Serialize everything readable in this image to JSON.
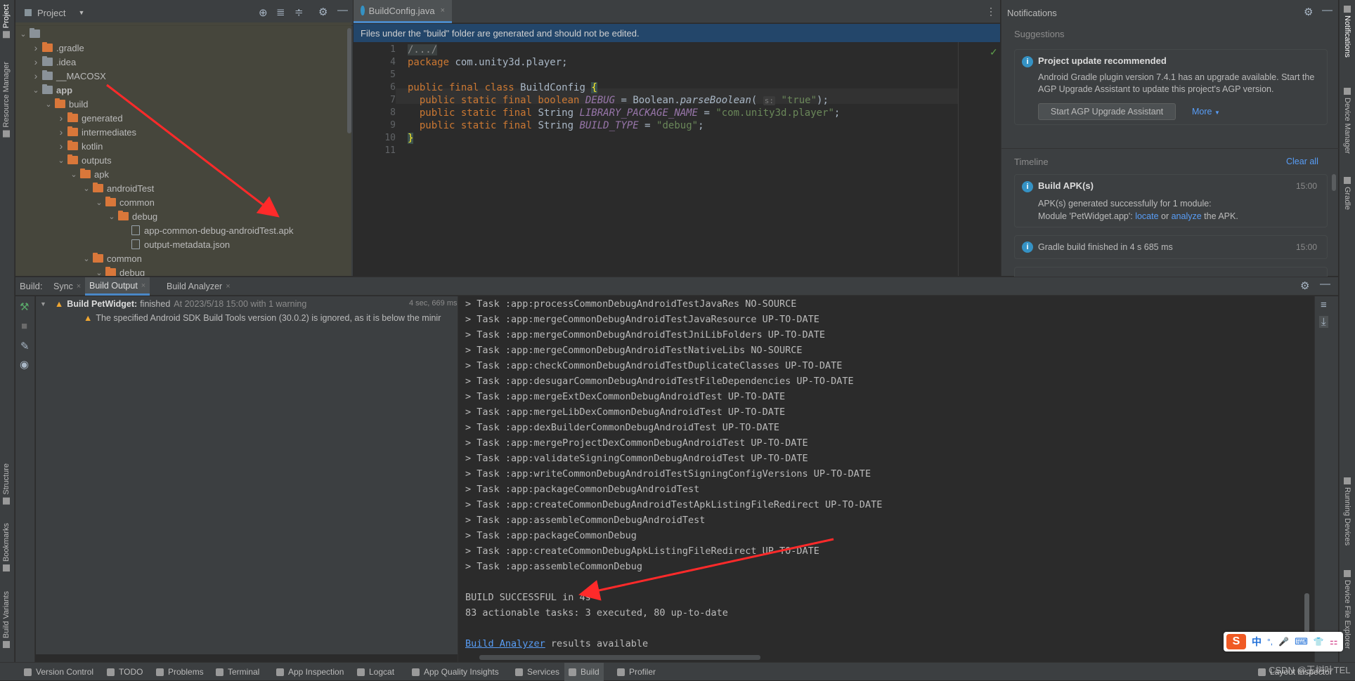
{
  "left_strip": {
    "project": "Project",
    "resource_manager": "Resource Manager",
    "structure": "Structure",
    "bookmarks": "Bookmarks",
    "build_variants": "Build Variants"
  },
  "right_strip": {
    "notifications": "Notifications",
    "device_manager": "Device Manager",
    "gradle": "Gradle",
    "running_devices": "Running Devices",
    "device_file_explorer": "Device File Explorer"
  },
  "project_panel": {
    "title": "Project",
    "tree": [
      {
        "label": "",
        "level": 0,
        "type": "root",
        "expanded": true
      },
      {
        "label": ".gradle",
        "level": 1,
        "type": "folder",
        "expanded": false
      },
      {
        "label": ".idea",
        "level": 1,
        "type": "folder-gray",
        "expanded": false
      },
      {
        "label": "__MACOSX",
        "level": 1,
        "type": "folder-gray",
        "expanded": false
      },
      {
        "label": "app",
        "level": 1,
        "type": "module",
        "expanded": true,
        "bold": true
      },
      {
        "label": "build",
        "level": 2,
        "type": "folder",
        "expanded": true
      },
      {
        "label": "generated",
        "level": 3,
        "type": "folder",
        "expanded": false
      },
      {
        "label": "intermediates",
        "level": 3,
        "type": "folder",
        "expanded": false
      },
      {
        "label": "kotlin",
        "level": 3,
        "type": "folder",
        "expanded": false
      },
      {
        "label": "outputs",
        "level": 3,
        "type": "folder",
        "expanded": true
      },
      {
        "label": "apk",
        "level": 4,
        "type": "folder",
        "expanded": true
      },
      {
        "label": "androidTest",
        "level": 5,
        "type": "folder",
        "expanded": true
      },
      {
        "label": "common",
        "level": 6,
        "type": "folder",
        "expanded": true
      },
      {
        "label": "debug",
        "level": 7,
        "type": "folder",
        "expanded": true
      },
      {
        "label": "app-common-debug-androidTest.apk",
        "level": 8,
        "type": "file"
      },
      {
        "label": "output-metadata.json",
        "level": 8,
        "type": "file"
      },
      {
        "label": "common",
        "level": 5,
        "type": "folder",
        "expanded": true
      },
      {
        "label": "debug",
        "level": 6,
        "type": "folder",
        "expanded": true
      }
    ]
  },
  "editor": {
    "tab_label": "BuildConfig.java",
    "banner": "Files under the \"build\" folder are generated and should not be edited.",
    "lines": [
      {
        "n": "1",
        "html": [
          [
            "/.../",
            "fold"
          ]
        ]
      },
      {
        "n": "4",
        "html": [
          [
            "package ",
            "kw"
          ],
          [
            "com.unity3d.player;",
            "plain"
          ]
        ]
      },
      {
        "n": "5",
        "html": []
      },
      {
        "n": "6",
        "html": [
          [
            "public final class ",
            "kw"
          ],
          [
            "BuildConfig ",
            "plain"
          ],
          [
            "{",
            "brace"
          ]
        ]
      },
      {
        "n": "7",
        "html": [
          [
            "  public static final boolean ",
            "kw"
          ],
          [
            "DEBUG",
            "field"
          ],
          [
            " = Boolean.",
            "plain"
          ],
          [
            "parseBoolean",
            "italic"
          ],
          [
            "( ",
            "plain"
          ],
          [
            "s:",
            "hint"
          ],
          [
            " \"true\"",
            "str"
          ],
          [
            ");",
            "plain"
          ]
        ]
      },
      {
        "n": "8",
        "html": [
          [
            "  public static final ",
            "kw"
          ],
          [
            "String ",
            "plain"
          ],
          [
            "LIBRARY_PACKAGE_NAME",
            "field"
          ],
          [
            " = ",
            "plain"
          ],
          [
            "\"com.unity3d.player\"",
            "str"
          ],
          [
            ";",
            "plain"
          ]
        ]
      },
      {
        "n": "9",
        "html": [
          [
            "  public static final ",
            "kw"
          ],
          [
            "String ",
            "plain"
          ],
          [
            "BUILD_TYPE",
            "field"
          ],
          [
            " = ",
            "plain"
          ],
          [
            "\"debug\"",
            "str"
          ],
          [
            ";",
            "plain"
          ]
        ]
      },
      {
        "n": "10",
        "html": [
          [
            "}",
            "brace"
          ]
        ]
      },
      {
        "n": "11",
        "html": []
      }
    ]
  },
  "notifications": {
    "title": "Notifications",
    "suggestions_label": "Suggestions",
    "suggestion": {
      "title": "Project update recommended",
      "body": "Android Gradle plugin version 7.4.1 has an upgrade available. Start the AGP Upgrade Assistant to update this project's AGP version.",
      "button": "Start AGP Upgrade Assistant",
      "more": "More"
    },
    "timeline_label": "Timeline",
    "clear_all": "Clear all",
    "events": [
      {
        "title": "Build APK(s)",
        "time": "15:00",
        "line1": "APK(s) generated successfully for 1 module:",
        "line2_prefix": "Module 'PetWidget.app': ",
        "link1": "locate",
        "or": " or ",
        "link2": "analyze",
        "suffix": " the APK."
      },
      {
        "title": "Gradle build finished in 4 s 685 ms",
        "time": "15:00"
      }
    ]
  },
  "build_panel": {
    "label": "Build:",
    "tabs": [
      "Sync",
      "Build Output",
      "Build Analyzer"
    ],
    "active_tab": 1,
    "tree_root": "Build PetWidget:",
    "tree_root_status": "finished",
    "tree_root_detail": "At 2023/5/18 15:00 with 1 warning",
    "tree_root_time": "4 sec, 669 ms",
    "warning": "The specified Android SDK Build Tools version (30.0.2) is ignored, as it is below the minir",
    "console": [
      "> Task :app:processCommonDebugAndroidTestJavaRes NO-SOURCE",
      "> Task :app:mergeCommonDebugAndroidTestJavaResource UP-TO-DATE",
      "> Task :app:mergeCommonDebugAndroidTestJniLibFolders UP-TO-DATE",
      "> Task :app:mergeCommonDebugAndroidTestNativeLibs NO-SOURCE",
      "> Task :app:checkCommonDebugAndroidTestDuplicateClasses UP-TO-DATE",
      "> Task :app:desugarCommonDebugAndroidTestFileDependencies UP-TO-DATE",
      "> Task :app:mergeExtDexCommonDebugAndroidTest UP-TO-DATE",
      "> Task :app:mergeLibDexCommonDebugAndroidTest UP-TO-DATE",
      "> Task :app:dexBuilderCommonDebugAndroidTest UP-TO-DATE",
      "> Task :app:mergeProjectDexCommonDebugAndroidTest UP-TO-DATE",
      "> Task :app:validateSigningCommonDebugAndroidTest UP-TO-DATE",
      "> Task :app:writeCommonDebugAndroidTestSigningConfigVersions UP-TO-DATE",
      "> Task :app:packageCommonDebugAndroidTest",
      "> Task :app:createCommonDebugAndroidTestApkListingFileRedirect UP-TO-DATE",
      "> Task :app:assembleCommonDebugAndroidTest",
      "> Task :app:packageCommonDebug",
      "> Task :app:createCommonDebugApkListingFileRedirect UP-TO-DATE",
      "> Task :app:assembleCommonDebug",
      "",
      "BUILD SUCCESSFUL in 4s",
      "83 actionable tasks: 3 executed, 80 up-to-date",
      ""
    ],
    "analyzer_link": "Build Analyzer",
    "analyzer_suffix": " results available"
  },
  "bottom_bar": [
    "Version Control",
    "TODO",
    "Problems",
    "Terminal",
    "App Inspection",
    "Logcat",
    "App Quality Insights",
    "Services",
    "Build",
    "Profiler"
  ],
  "active_bottom": "Build",
  "status_right": "Layout Inspector",
  "watermark": "CSDN @王树叶TEL",
  "ime_bar": [
    "中",
    "°,",
    "🎤",
    "⌨",
    "👕",
    "⚏"
  ],
  "colors": {
    "keyword": "#cc7832",
    "string": "#6a8759",
    "field": "#9876aa",
    "accent": "#3592c4",
    "folder": "#d9773a",
    "banner": "#23466a",
    "arrow": "#ff2a2a"
  }
}
